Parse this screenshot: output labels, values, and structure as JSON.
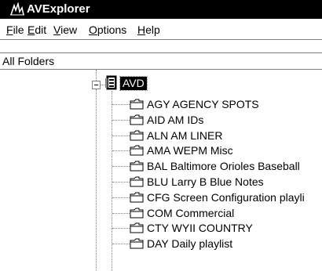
{
  "window": {
    "title": "AVExplorer"
  },
  "menu": [
    {
      "mnemonic": "F",
      "rest": "ile"
    },
    {
      "mnemonic": "E",
      "rest": "dit"
    },
    {
      "mnemonic": "V",
      "rest": "iew"
    },
    {
      "mnemonic": "O",
      "rest": "ptions"
    },
    {
      "mnemonic": "H",
      "rest": "elp"
    }
  ],
  "pane": {
    "header": "All Folders"
  },
  "tree": {
    "root": {
      "label": "AVD",
      "icon": "media-database-icon",
      "expanded": true
    },
    "folders": [
      {
        "label": "AGY AGENCY SPOTS"
      },
      {
        "label": "AID AM IDs"
      },
      {
        "label": "ALN AM LINER"
      },
      {
        "label": "AMA WEPM Misc"
      },
      {
        "label": "BAL Baltimore Orioles Baseball"
      },
      {
        "label": "BLU Larry B Blue Notes"
      },
      {
        "label": "CFG Screen Configuration playli"
      },
      {
        "label": "COM Commercial"
      },
      {
        "label": "CTY WYII COUNTRY"
      },
      {
        "label": "DAY Daily playlist"
      }
    ]
  },
  "colors": {
    "titlebar": "#000000",
    "selection": "#000000",
    "background": "#ffffff",
    "folder": "#ffffff"
  }
}
